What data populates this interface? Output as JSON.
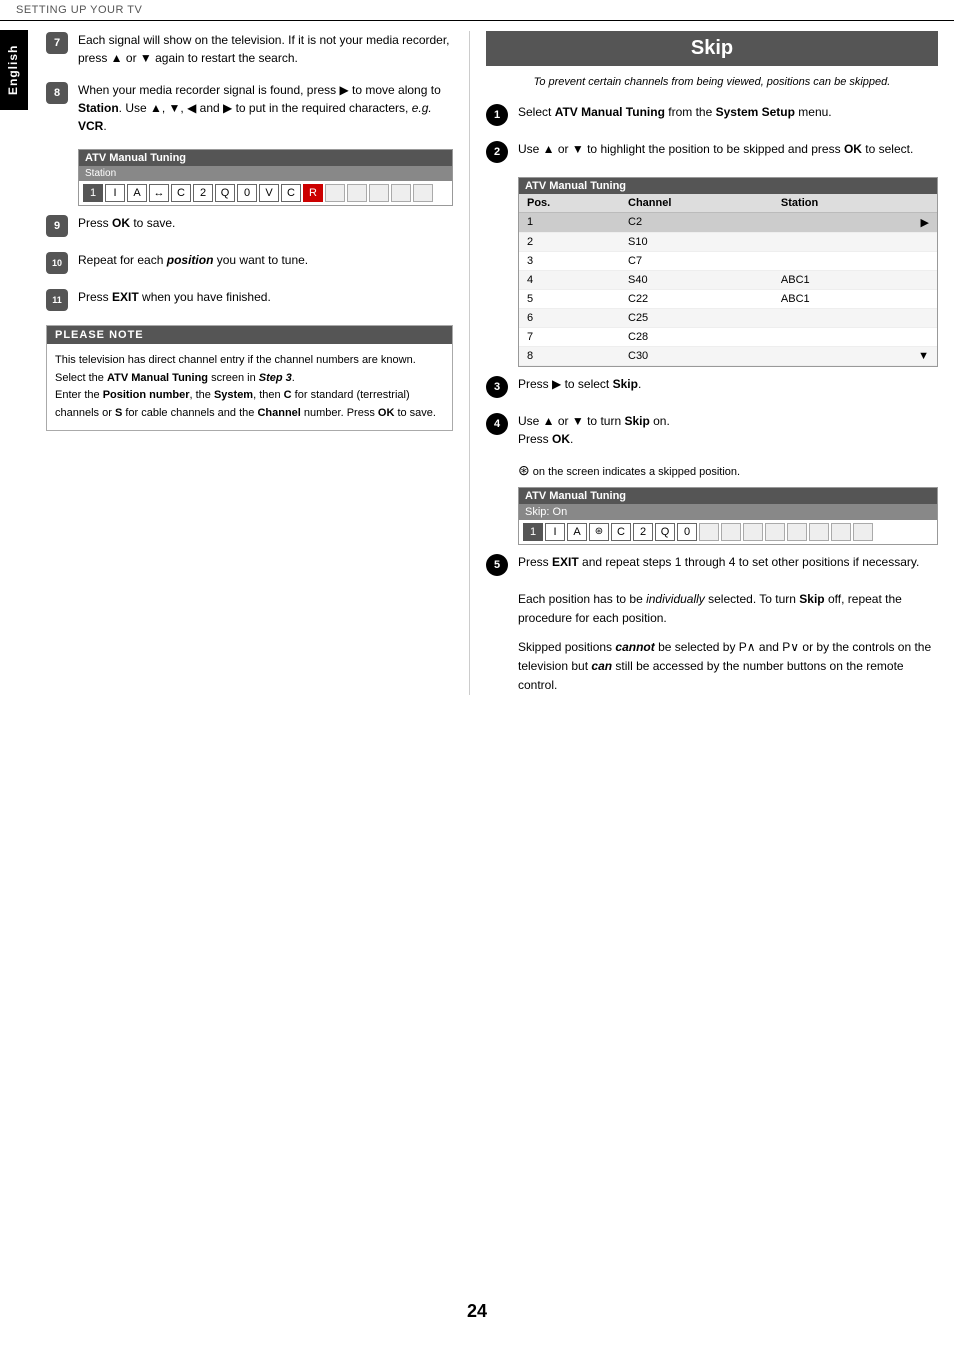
{
  "topbar": {
    "label": "SETTING UP YOUR TV"
  },
  "side_tab": {
    "label": "English"
  },
  "page_number": "24",
  "left_column": {
    "steps": [
      {
        "id": "7",
        "text_parts": [
          {
            "type": "plain",
            "text": "Each signal will show on the television. If it is not your media recorder, press "
          },
          {
            "type": "symbol",
            "text": "▲"
          },
          {
            "type": "plain",
            "text": " or "
          },
          {
            "type": "symbol",
            "text": "▼"
          },
          {
            "type": "plain",
            "text": " again to restart the search."
          }
        ]
      },
      {
        "id": "8",
        "text_parts": [
          {
            "type": "plain",
            "text": "When your media recorder signal is found, press "
          },
          {
            "type": "symbol",
            "text": "▶"
          },
          {
            "type": "plain",
            "text": " to move along to "
          },
          {
            "type": "bold",
            "text": "Station"
          },
          {
            "type": "plain",
            "text": ". Use "
          },
          {
            "type": "symbol",
            "text": "▲"
          },
          {
            "type": "plain",
            "text": ", "
          },
          {
            "type": "symbol",
            "text": "▼"
          },
          {
            "type": "plain",
            "text": ", "
          },
          {
            "type": "symbol",
            "text": "◀"
          },
          {
            "type": "plain",
            "text": " and "
          },
          {
            "type": "symbol",
            "text": "▶"
          },
          {
            "type": "plain",
            "text": " to put in the required characters, "
          },
          {
            "type": "italic",
            "text": "e.g."
          },
          {
            "type": "plain",
            "text": " "
          },
          {
            "type": "bold",
            "text": "VCR"
          },
          {
            "type": "plain",
            "text": "."
          }
        ],
        "has_box": true,
        "box": {
          "title": "ATV Manual Tuning",
          "subtitle": "Station",
          "cells": [
            "1",
            "I",
            "A",
            "↔",
            "C",
            "2",
            "Q",
            "0",
            "V",
            "C",
            "R",
            "",
            "",
            "",
            "",
            ""
          ]
        }
      },
      {
        "id": "9",
        "text_parts": [
          {
            "type": "plain",
            "text": "Press "
          },
          {
            "type": "bold",
            "text": "OK"
          },
          {
            "type": "plain",
            "text": " to save."
          }
        ]
      },
      {
        "id": "10",
        "text_parts": [
          {
            "type": "plain",
            "text": "Repeat for each "
          },
          {
            "type": "bold_italic",
            "text": "position"
          },
          {
            "type": "plain",
            "text": " you want to tune."
          }
        ]
      },
      {
        "id": "11",
        "text_parts": [
          {
            "type": "plain",
            "text": "Press "
          },
          {
            "type": "bold",
            "text": "EXIT"
          },
          {
            "type": "plain",
            "text": " when you have finished."
          }
        ]
      }
    ],
    "please_note": {
      "title": "PLEASE NOTE",
      "lines": [
        "This television has direct channel entry if the channel numbers are known.",
        "Select the ATV Manual Tuning screen in Step 3.",
        "Enter the Position number, the System, then C for standard (terrestrial) channels or S for cable channels and the Channel number. Press OK to save."
      ]
    }
  },
  "right_column": {
    "skip_title": "Skip",
    "skip_intro": "To prevent certain channels from being viewed, positions can be skipped.",
    "steps": [
      {
        "id": "1",
        "text_parts": [
          {
            "type": "plain",
            "text": "Select "
          },
          {
            "type": "bold",
            "text": "ATV Manual Tuning"
          },
          {
            "type": "plain",
            "text": " from the "
          },
          {
            "type": "bold",
            "text": "System Setup"
          },
          {
            "type": "plain",
            "text": " menu."
          }
        ]
      },
      {
        "id": "2",
        "text_parts": [
          {
            "type": "plain",
            "text": "Use "
          },
          {
            "type": "symbol",
            "text": "▲"
          },
          {
            "type": "plain",
            "text": " or "
          },
          {
            "type": "symbol",
            "text": "▼"
          },
          {
            "type": "plain",
            "text": " to highlight the position to be skipped and press "
          },
          {
            "type": "bold",
            "text": "OK"
          },
          {
            "type": "plain",
            "text": " to select."
          }
        ],
        "has_table": true,
        "table": {
          "title": "ATV Manual Tuning",
          "headers": [
            "Pos.",
            "Channel",
            "Station"
          ],
          "rows": [
            {
              "pos": "1",
              "channel": "C2",
              "station": "",
              "highlight": true
            },
            {
              "pos": "2",
              "channel": "S10",
              "station": ""
            },
            {
              "pos": "3",
              "channel": "C7",
              "station": ""
            },
            {
              "pos": "4",
              "channel": "S40",
              "station": "ABC1"
            },
            {
              "pos": "5",
              "channel": "C22",
              "station": "ABC1"
            },
            {
              "pos": "6",
              "channel": "C25",
              "station": ""
            },
            {
              "pos": "7",
              "channel": "C28",
              "station": ""
            },
            {
              "pos": "8",
              "channel": "C30",
              "station": ""
            }
          ]
        }
      },
      {
        "id": "3",
        "text_parts": [
          {
            "type": "plain",
            "text": "Press "
          },
          {
            "type": "symbol",
            "text": "▶"
          },
          {
            "type": "plain",
            "text": " to select "
          },
          {
            "type": "bold",
            "text": "Skip"
          },
          {
            "type": "plain",
            "text": "."
          }
        ]
      },
      {
        "id": "4",
        "text_parts": [
          {
            "type": "plain",
            "text": "Use "
          },
          {
            "type": "symbol",
            "text": "▲"
          },
          {
            "type": "plain",
            "text": " or "
          },
          {
            "type": "symbol",
            "text": "▼"
          },
          {
            "type": "plain",
            "text": " to turn "
          },
          {
            "type": "bold",
            "text": "Skip"
          },
          {
            "type": "plain",
            "text": " on."
          },
          {
            "type": "linebreak"
          },
          {
            "type": "plain",
            "text": "Press "
          },
          {
            "type": "bold",
            "text": "OK"
          },
          {
            "type": "plain",
            "text": "."
          }
        ],
        "has_note": true,
        "note": "⊛ on the screen indicates a skipped position.",
        "has_skip_box": true,
        "skip_box": {
          "title": "ATV Manual Tuning",
          "subtitle": "Skip: On",
          "cells": [
            "1",
            "I",
            "A",
            "⊛",
            "C",
            "2",
            "Q",
            "0",
            "",
            "",
            "",
            "",
            "",
            "",
            "",
            ""
          ]
        }
      },
      {
        "id": "5",
        "text_parts": [
          {
            "type": "plain",
            "text": "Press "
          },
          {
            "type": "bold",
            "text": "EXIT"
          },
          {
            "type": "plain",
            "text": " and repeat steps 1 through 4 to set other positions if necessary."
          }
        ],
        "extra_paras": [
          "Each position has to be <i>individually</i> selected. To turn <b>Skip</b> off, repeat the procedure for each position.",
          "Skipped positions <b><i>cannot</i></b> be selected by P∧ and P∨ or by the controls on the television but <b><i>can</i></b> still be accessed by the number buttons on the remote control."
        ]
      }
    ]
  }
}
